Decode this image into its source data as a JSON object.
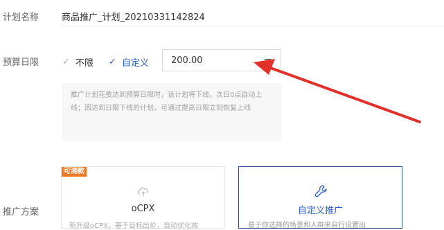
{
  "form": {
    "plan_name": {
      "label": "计划名称",
      "value": "商品推广_计划_20210331142824"
    },
    "budget": {
      "label": "预算日限",
      "options": [
        {
          "label": "不限",
          "selected": false
        },
        {
          "label": "自定义",
          "selected": true
        }
      ],
      "value": "200.00",
      "unit": "元",
      "hint": "推广计划花费达到预算日限时，该计划将下线，次日0点自动上线；因达到日限下线的计划，可通过提高日限立刻恢复上线"
    },
    "scheme": {
      "label": "推广方案",
      "cards": [
        {
          "tag": "可测款",
          "title": "oCPX",
          "desc": "新升级oCPX，基于目标出价，自动优化效",
          "icon": "cloud-sync-icon",
          "selected": false
        },
        {
          "title": "自定义推广",
          "desc": "基于你选择的场景和人群来自行设置出",
          "icon": "wrench-icon",
          "selected": true
        }
      ]
    }
  },
  "colors": {
    "accent_blue": "#2f5fc4",
    "card_selected_border": "#2b4a8b",
    "tag_orange": "#ee7a2a",
    "annotation_arrow": "#e0322b"
  }
}
